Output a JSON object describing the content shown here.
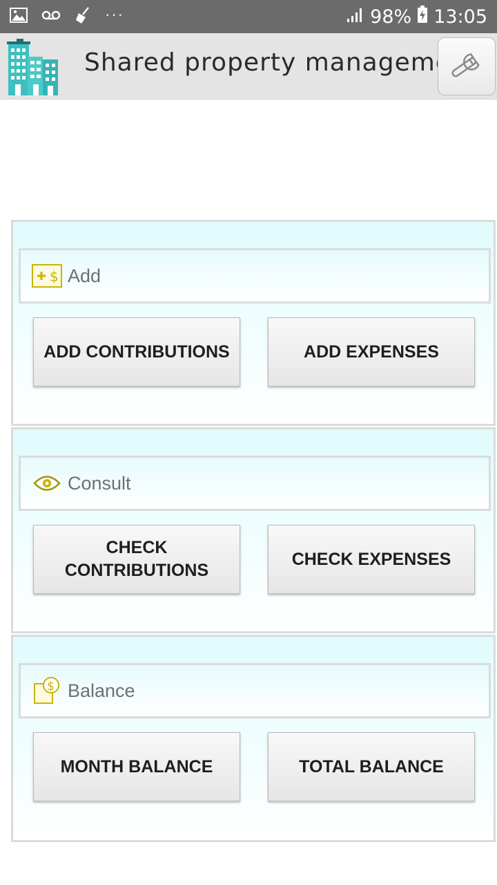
{
  "status_bar": {
    "icons": [
      "image-icon",
      "voicemail-icon",
      "broom-icon"
    ],
    "more": "···",
    "battery": "98%",
    "time": "13:05"
  },
  "app_bar": {
    "title": "Shared property management",
    "logo_icon": "buildings-icon",
    "settings_icon": "wrench-icon"
  },
  "sections": {
    "add": {
      "label": "Add",
      "icon": "add-money-icon",
      "left_button": "ADD CONTRIBUTIONS",
      "right_button": "ADD EXPENSES"
    },
    "consult": {
      "label": "Consult",
      "icon": "eye-icon",
      "left_button": "CHECK CONTRIBUTIONS",
      "right_button": "CHECK EXPENSES"
    },
    "balance": {
      "label": "Balance",
      "icon": "balance-icon",
      "left_button": "MONTH BALANCE",
      "right_button": "TOTAL BALANCE"
    }
  },
  "colors": {
    "accent_gold": "#c8b400",
    "panel_top": "#e0fbfc",
    "logo_teal": "#3ebfc0"
  }
}
